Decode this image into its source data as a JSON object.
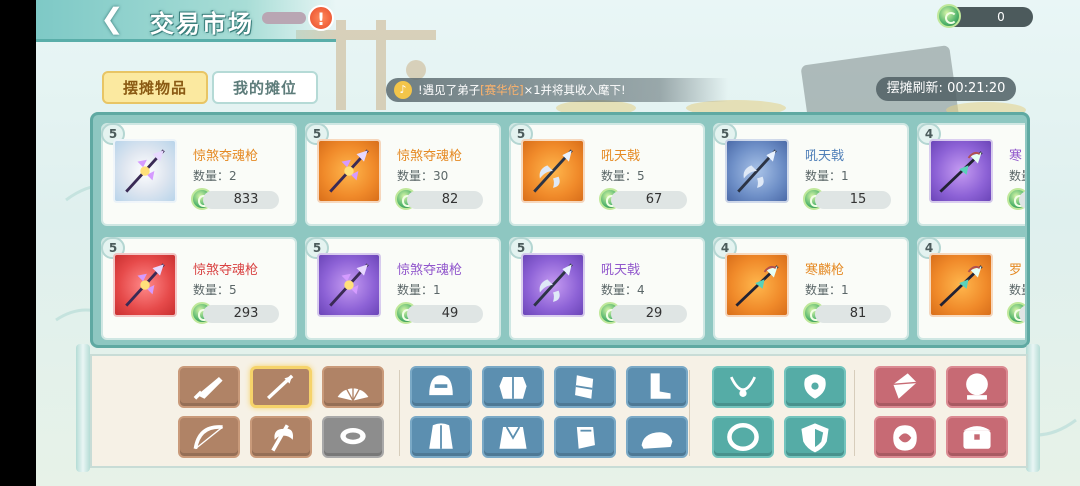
{
  "header": {
    "title": "交易市场"
  },
  "currency": {
    "amount": "0",
    "icon": "jade-coin-icon"
  },
  "tabs": [
    {
      "label": "摆摊物品",
      "active": true
    },
    {
      "label": "我的摊位",
      "active": false
    }
  ],
  "notice": {
    "prefix": "!遇见了弟子",
    "highlight": "[赛华佗]",
    "suffix": "×1并将其收入麾下!"
  },
  "refresh": {
    "label": "摆摊刷新:",
    "time": "00:21:20"
  },
  "qty_label": "数量：",
  "items": [
    {
      "tier": "5",
      "name": "惊煞夺魂枪",
      "qty": "2",
      "price": "833",
      "rarity": "orange",
      "bg": "silver",
      "weapon": "spear"
    },
    {
      "tier": "5",
      "name": "惊煞夺魂枪",
      "qty": "30",
      "price": "82",
      "rarity": "orange",
      "bg": "orange",
      "weapon": "spear"
    },
    {
      "tier": "5",
      "name": "吼天戟",
      "qty": "5",
      "price": "67",
      "rarity": "orange",
      "bg": "orange",
      "weapon": "halberd"
    },
    {
      "tier": "5",
      "name": "吼天戟",
      "qty": "1",
      "price": "15",
      "rarity": "blue",
      "bg": "blue",
      "weapon": "halberd"
    },
    {
      "tier": "4",
      "name": "寒",
      "qty": "",
      "price": "",
      "rarity": "purple",
      "bg": "purple",
      "weapon": "lance"
    },
    {
      "tier": "5",
      "name": "惊煞夺魂枪",
      "qty": "5",
      "price": "293",
      "rarity": "red",
      "bg": "red",
      "weapon": "spear"
    },
    {
      "tier": "5",
      "name": "惊煞夺魂枪",
      "qty": "1",
      "price": "49",
      "rarity": "purple",
      "bg": "purple",
      "weapon": "spear"
    },
    {
      "tier": "5",
      "name": "吼天戟",
      "qty": "4",
      "price": "29",
      "rarity": "purple",
      "bg": "purple",
      "weapon": "halberd"
    },
    {
      "tier": "4",
      "name": "寒麟枪",
      "qty": "1",
      "price": "81",
      "rarity": "orange",
      "bg": "orange",
      "weapon": "lance"
    },
    {
      "tier": "4",
      "name": "罗",
      "qty": "",
      "price": "",
      "rarity": "orange",
      "bg": "orange",
      "weapon": "lance"
    }
  ],
  "filters": [
    {
      "name": "sword-filter-icon",
      "style": "brown",
      "glyph": "sword",
      "selected": false
    },
    {
      "name": "spear-filter-icon",
      "style": "brown",
      "glyph": "spear",
      "selected": true
    },
    {
      "name": "fan-filter-icon",
      "style": "brown",
      "glyph": "fan",
      "selected": false
    },
    {
      "name": "bow-filter-icon",
      "style": "brown",
      "glyph": "bow",
      "selected": false
    },
    {
      "name": "axe-filter-icon",
      "style": "brown",
      "glyph": "axe",
      "selected": false
    },
    {
      "name": "ring-filter-icon",
      "style": "gray",
      "glyph": "band",
      "selected": false
    },
    {
      "name": "helmet-filter-icon",
      "style": "blue",
      "glyph": "helmet",
      "selected": false
    },
    {
      "name": "armor-filter-icon",
      "style": "blue",
      "glyph": "armor",
      "selected": false
    },
    {
      "name": "bracer-filter-icon",
      "style": "blue",
      "glyph": "bracer",
      "selected": false
    },
    {
      "name": "boot-filter-icon",
      "style": "blue",
      "glyph": "boot",
      "selected": false
    },
    {
      "name": "cloak-filter-icon",
      "style": "blue",
      "glyph": "cloak",
      "selected": false
    },
    {
      "name": "robe-filter-icon",
      "style": "blue",
      "glyph": "robe",
      "selected": false
    },
    {
      "name": "gauntlet-filter-icon",
      "style": "blue",
      "glyph": "gauntlet",
      "selected": false
    },
    {
      "name": "shoe-filter-icon",
      "style": "blue",
      "glyph": "shoe",
      "selected": false
    },
    {
      "name": "necklace-filter-icon",
      "style": "teal",
      "glyph": "necklace",
      "selected": false
    },
    {
      "name": "amulet-filter-icon",
      "style": "teal",
      "glyph": "amulet",
      "selected": false
    },
    {
      "name": "bracelet-filter-icon",
      "style": "teal",
      "glyph": "bracelet",
      "selected": false
    },
    {
      "name": "shield-filter-icon",
      "style": "teal",
      "glyph": "shield",
      "selected": false
    },
    {
      "name": "crystal-filter-icon",
      "style": "red",
      "glyph": "crystal",
      "selected": false
    },
    {
      "name": "orb-filter-icon",
      "style": "red",
      "glyph": "orb",
      "selected": false
    },
    {
      "name": "talisman-filter-icon",
      "style": "red",
      "glyph": "talisman",
      "selected": false
    },
    {
      "name": "chest-filter-icon",
      "style": "red",
      "glyph": "chest",
      "selected": false
    }
  ],
  "colors": {
    "orange": "#e58a24",
    "blue": "#4f7fb8",
    "purple": "#9157cc",
    "red": "#d94343",
    "accent": "#5fa9a2"
  }
}
